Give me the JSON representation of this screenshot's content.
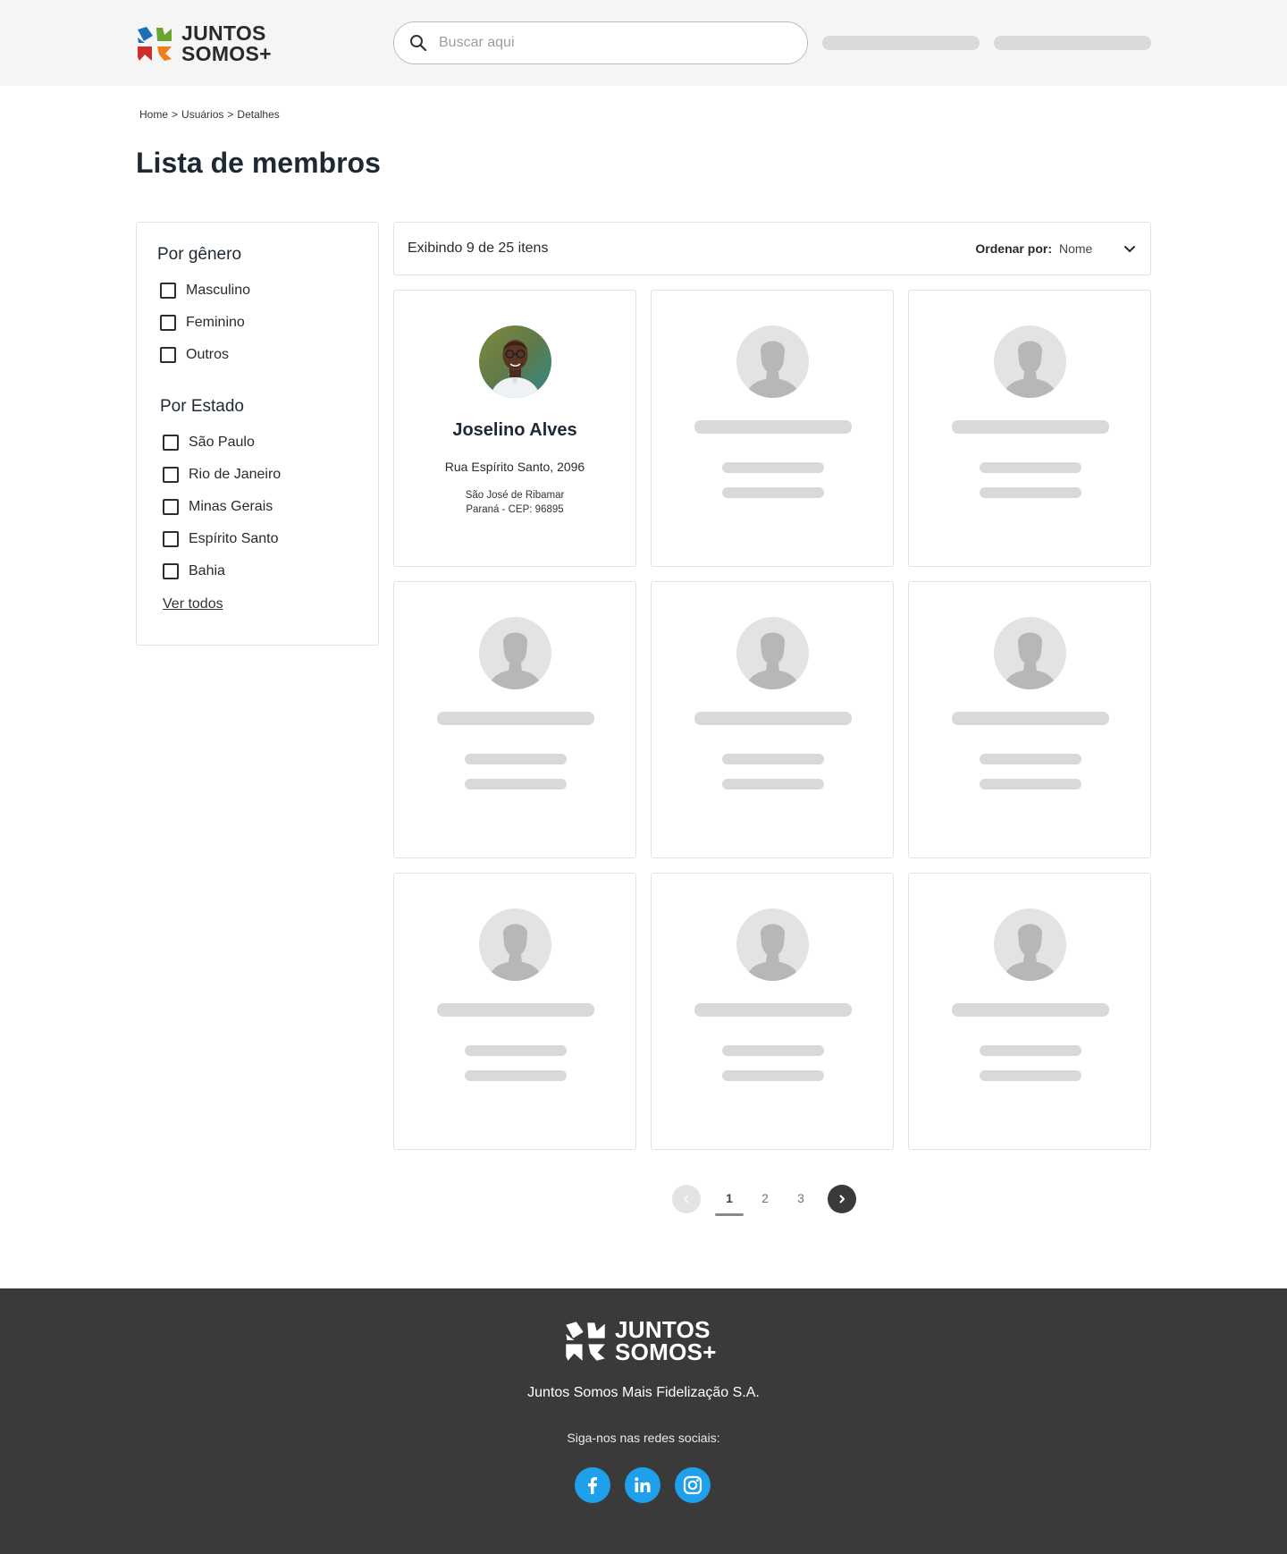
{
  "brand": {
    "line1": "JUNTOS",
    "line2": "SOMOS+",
    "colors": {
      "blue": "#1e6fb8",
      "green": "#6aa532",
      "red": "#cf2e2e",
      "orange": "#ef7d1a"
    }
  },
  "search": {
    "placeholder": "Buscar aqui"
  },
  "breadcrumb": [
    "Home",
    ">",
    "Usuários",
    ">",
    "Detalhes"
  ],
  "page_title": "Lista de membros",
  "filters": {
    "gender": {
      "title": "Por gênero",
      "options": [
        "Masculino",
        "Feminino",
        "Outros"
      ]
    },
    "state": {
      "title": "Por Estado",
      "options": [
        "São Paulo",
        "Rio de Janeiro",
        "Minas Gerais",
        "Espírito Santo",
        "Bahia"
      ]
    },
    "see_all": "Ver todos"
  },
  "results": {
    "count_text": "Exibindo 9 de  25 itens",
    "sort_label": "Ordenar por:",
    "sort_value": "Nome"
  },
  "members": [
    {
      "name": "Joselino Alves",
      "street": "Rua Espírito Santo, 2096",
      "city": "São José de Ribamar",
      "state_cep": "Paraná - CEP: 96895"
    }
  ],
  "placeholder_cards": 8,
  "pagination": {
    "pages": [
      "1",
      "2",
      "3"
    ],
    "current": "1"
  },
  "footer": {
    "company": "Juntos Somos Mais Fidelização S.A.",
    "follow": "Siga-nos nas redes sociais:",
    "social": [
      "facebook-icon",
      "linkedin-icon",
      "instagram-icon"
    ],
    "social_color": "#1fa0ea"
  }
}
